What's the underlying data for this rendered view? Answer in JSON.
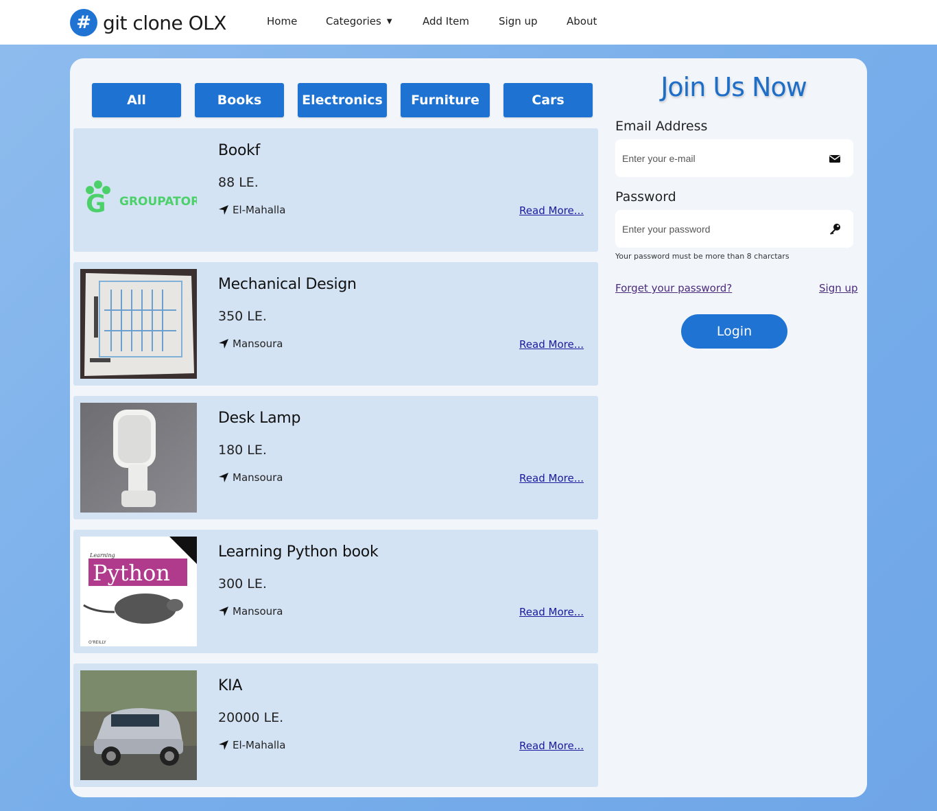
{
  "navbar": {
    "brand_icon": "#",
    "brand_name": "git clone OLX",
    "links": [
      "Home",
      "Categories",
      "Add Item",
      "Sign up",
      "About"
    ]
  },
  "categories": [
    "All",
    "Books",
    "Electronics",
    "Furniture",
    "Cars"
  ],
  "items": [
    {
      "title": "Bookf",
      "price": "88 LE.",
      "location": "El-Mahalla",
      "link": "Read More...",
      "image_text": "GROUPATOR"
    },
    {
      "title": "Mechanical Design",
      "price": "350 LE.",
      "location": "Mansoura",
      "link": "Read More..."
    },
    {
      "title": "Desk Lamp",
      "price": "180 LE.",
      "location": "Mansoura",
      "link": "Read More..."
    },
    {
      "title": "Learning Python book",
      "price": "300 LE.",
      "location": "Mansoura",
      "link": "Read More...",
      "image_text": "Python",
      "image_subtext": "Learning",
      "image_publisher": "O'REILLY"
    },
    {
      "title": "KIA",
      "price": "20000 LE.",
      "location": "El-Mahalla",
      "link": "Read More..."
    }
  ],
  "login": {
    "title": "Join Us Now",
    "email_label": "Email Address",
    "email_placeholder": "Enter your e-mail",
    "password_label": "Password",
    "password_placeholder": "Enter your password",
    "password_help": "Your password must be more than 8 charctars",
    "forgot_link": "Forget your password?",
    "signup_link": "Sign up",
    "login_button": "Login"
  },
  "colors": {
    "primary": "#1e73d2",
    "card_bg": "#d3e3f4",
    "panel_bg": "#f2f6fb",
    "page_bg": "#7fb2eb"
  }
}
